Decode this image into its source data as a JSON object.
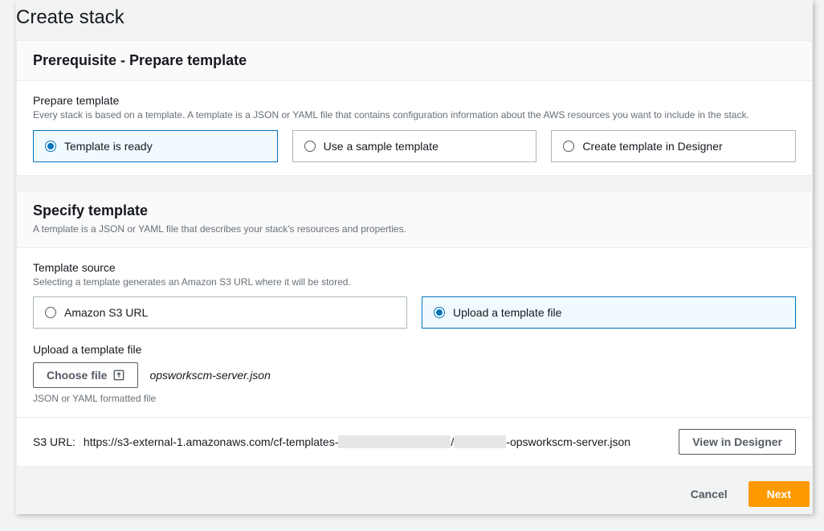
{
  "page_title": "Create stack",
  "prereq": {
    "heading": "Prerequisite - Prepare template",
    "field_label": "Prepare template",
    "field_desc": "Every stack is based on a template. A template is a JSON or YAML file that contains configuration information about the AWS resources you want to include in the stack.",
    "options": {
      "ready": "Template is ready",
      "sample": "Use a sample template",
      "designer": "Create template in Designer"
    }
  },
  "specify": {
    "heading": "Specify template",
    "subtext": "A template is a JSON or YAML file that describes your stack's resources and properties.",
    "source_label": "Template source",
    "source_desc": "Selecting a template generates an Amazon S3 URL where it will be stored.",
    "options": {
      "s3": "Amazon S3 URL",
      "upload": "Upload a template file"
    },
    "upload_label": "Upload a template file",
    "choose_file": "Choose file",
    "filename": "opsworkscm-server.json",
    "hint": "JSON or YAML formatted file",
    "s3_url_label": "S3 URL:",
    "s3_url_prefix": "https://s3-external-1.amazonaws.com/cf-templates-",
    "s3_url_sep": "/",
    "s3_url_suffix": "-opsworkscm-server.json",
    "view_designer": "View in Designer"
  },
  "actions": {
    "cancel": "Cancel",
    "next": "Next"
  }
}
